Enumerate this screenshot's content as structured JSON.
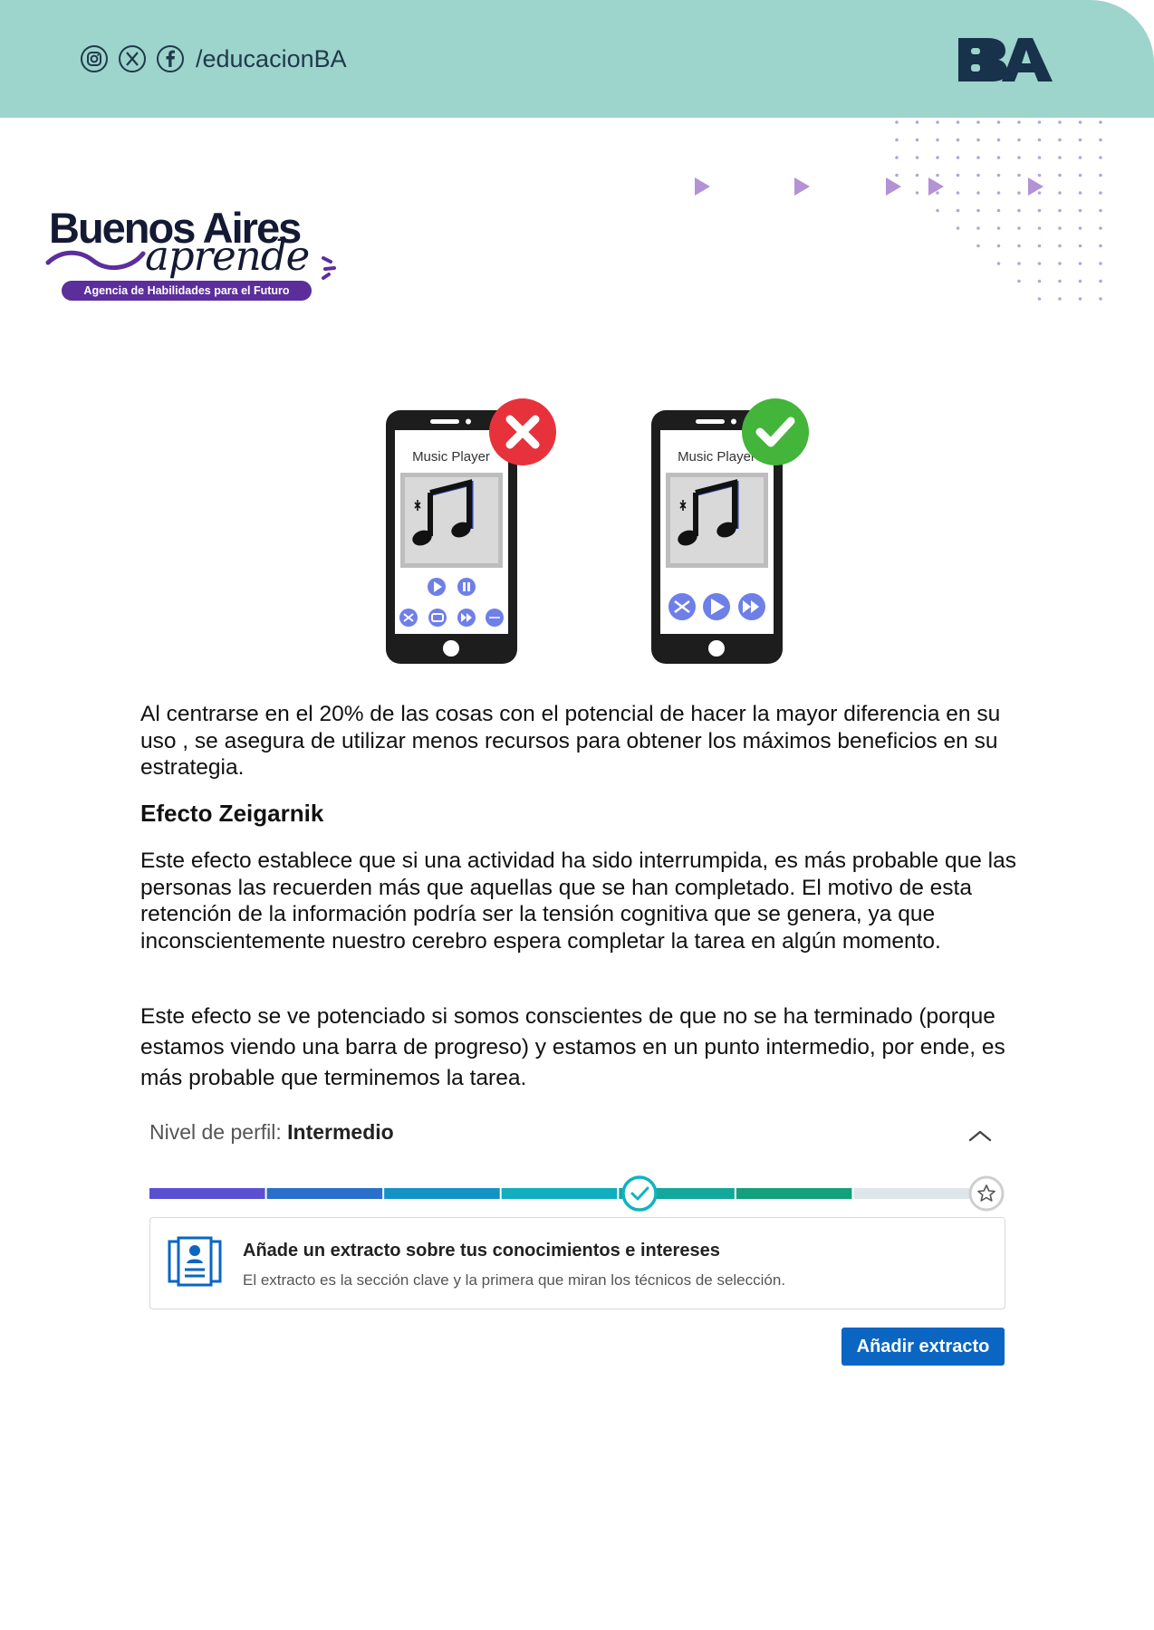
{
  "header": {
    "social_handle": "/educacionBA",
    "social_icons": [
      "instagram-icon",
      "x-icon",
      "facebook-icon"
    ],
    "logo_text": "BA",
    "band_color": "#9dd4cc"
  },
  "brand": {
    "line1": "Buenos Aires",
    "line2": "aprende",
    "tagline": "Agencia de Habilidades para el Futuro",
    "accent_color": "#5b2e9c"
  },
  "illustration": {
    "phone_left": {
      "title": "Music Player",
      "status": "incorrect"
    },
    "phone_right": {
      "title": "Music Player",
      "status": "correct"
    }
  },
  "body": {
    "paragraph1": "Al centrarse en el 20% de las cosas con el potencial de hacer la mayor diferencia en su uso , se asegura de utilizar menos recursos para obtener los máximos beneficios en su estrategia.",
    "heading": "Efecto Zeigarnik",
    "paragraph2": "Este efecto establece que si una actividad ha sido interrumpida, es más probable que las personas las recuerden más que aquellas que se han completado. El motivo de esta retención de la información podría ser la tensión cognitiva que se genera, ya que inconscientemente nuestro cerebro espera completar la tarea en algún momento.",
    "paragraph3": "Este efecto se ve potenciado si somos conscientes de que no se ha terminado (porque estamos viendo una barra de progreso) y estamos en un punto intermedio, por ende, es más probable que terminemos la tarea."
  },
  "profile_widget": {
    "level_label": "Nivel de perfil:",
    "level_value": "Intermedio",
    "progress_segments": 7,
    "filled_segments": 6,
    "marker_after_segment": 4,
    "card_title": "Añade un extracto sobre tus conocimientos e intereses",
    "card_subtitle": "El extracto es la sección clave y la primera que miran los técnicos de selección.",
    "button_label": "Añadir extracto",
    "button_color": "#0a66c2"
  }
}
